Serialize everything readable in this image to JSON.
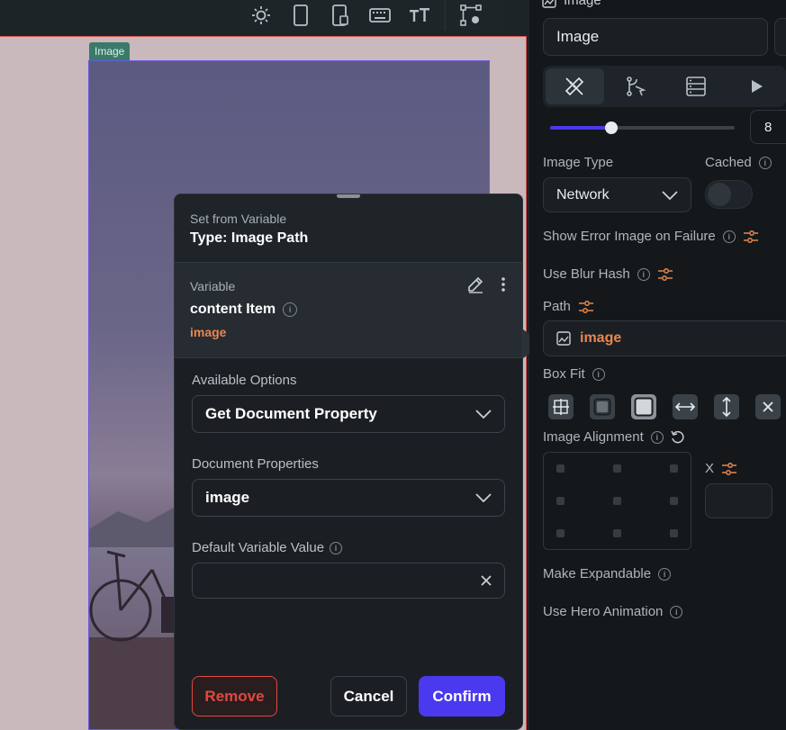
{
  "canvas": {
    "image_tag": "Image"
  },
  "popup": {
    "subtitle": "Set from Variable",
    "title": "Type: Image Path",
    "variable_label": "Variable",
    "variable_name": "content Item",
    "variable_field": "image",
    "available_options_label": "Available Options",
    "available_options_value": "Get Document Property",
    "document_properties_label": "Document Properties",
    "document_properties_value": "image",
    "default_value_label": "Default Variable Value",
    "default_value": "",
    "remove_label": "Remove",
    "cancel_label": "Cancel",
    "confirm_label": "Confirm"
  },
  "panel": {
    "section_title": "Image",
    "name_value": "Image",
    "slider_value": "8",
    "slider_fraction": 0.33,
    "image_type_label": "Image Type",
    "image_type_value": "Network",
    "cached_label": "Cached",
    "show_error_label": "Show Error Image on Failure",
    "blur_hash_label": "Use Blur Hash",
    "path_label": "Path",
    "path_value": "image",
    "box_fit_label": "Box Fit",
    "image_alignment_label": "Image Alignment",
    "x_label": "X",
    "make_expandable_label": "Make Expandable",
    "hero_animation_label": "Use Hero Animation"
  },
  "colors": {
    "accent": "#4b39ef",
    "variable_orange": "#e8864e",
    "danger": "#e0493f"
  }
}
